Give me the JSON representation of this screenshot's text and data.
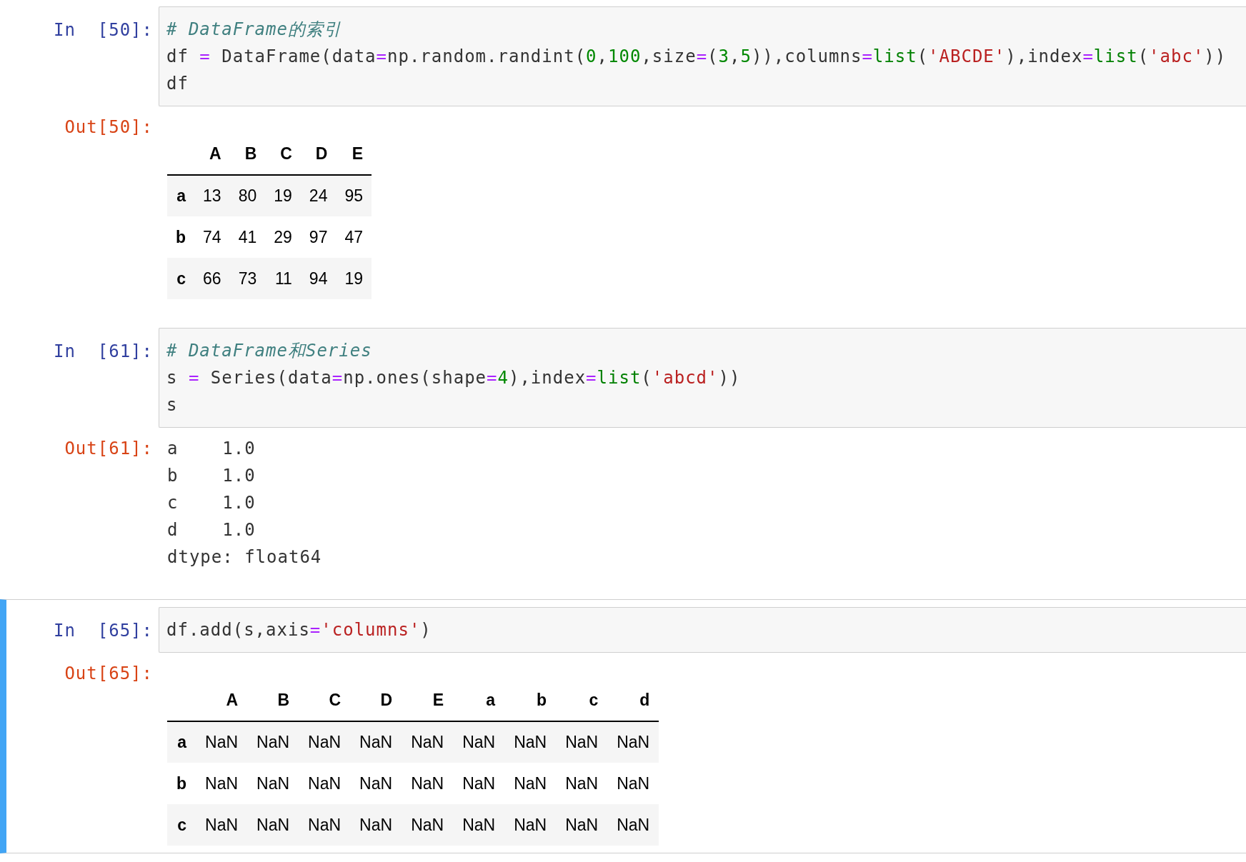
{
  "cells": [
    {
      "prompt": "In  [50]:",
      "selected": false,
      "code": [
        [
          {
            "t": "# DataFrame的索引",
            "kind": "comment"
          }
        ],
        [
          {
            "t": "df ",
            "kind": "plain"
          },
          {
            "t": "=",
            "kind": "op"
          },
          {
            "t": " DataFrame(data",
            "kind": "plain"
          },
          {
            "t": "=",
            "kind": "op"
          },
          {
            "t": "np.random.randint(",
            "kind": "plain"
          },
          {
            "t": "0",
            "kind": "number"
          },
          {
            "t": ",",
            "kind": "plain"
          },
          {
            "t": "100",
            "kind": "number"
          },
          {
            "t": ",size",
            "kind": "plain"
          },
          {
            "t": "=",
            "kind": "op"
          },
          {
            "t": "(",
            "kind": "plain"
          },
          {
            "t": "3",
            "kind": "number"
          },
          {
            "t": ",",
            "kind": "plain"
          },
          {
            "t": "5",
            "kind": "number"
          },
          {
            "t": ")),columns",
            "kind": "plain"
          },
          {
            "t": "=",
            "kind": "op"
          },
          {
            "t": "list",
            "kind": "builtin"
          },
          {
            "t": "(",
            "kind": "plain"
          },
          {
            "t": "'ABCDE'",
            "kind": "string"
          },
          {
            "t": "),index",
            "kind": "plain"
          },
          {
            "t": "=",
            "kind": "op"
          },
          {
            "t": "list",
            "kind": "builtin"
          },
          {
            "t": "(",
            "kind": "plain"
          },
          {
            "t": "'abc'",
            "kind": "string"
          },
          {
            "t": "))",
            "kind": "plain"
          }
        ],
        [
          {
            "t": "df",
            "kind": "plain"
          }
        ]
      ],
      "output": {
        "prompt": "Out[50]:",
        "kind": "table",
        "columns": [
          "A",
          "B",
          "C",
          "D",
          "E"
        ],
        "rows": [
          {
            "index": "a",
            "cells": [
              "13",
              "80",
              "19",
              "24",
              "95"
            ]
          },
          {
            "index": "b",
            "cells": [
              "74",
              "41",
              "29",
              "97",
              "47"
            ]
          },
          {
            "index": "c",
            "cells": [
              "66",
              "73",
              "11",
              "94",
              "19"
            ]
          }
        ]
      }
    },
    {
      "prompt": "In  [61]:",
      "selected": false,
      "code": [
        [
          {
            "t": "# DataFrame和Series",
            "kind": "comment"
          }
        ],
        [
          {
            "t": "s ",
            "kind": "plain"
          },
          {
            "t": "=",
            "kind": "op"
          },
          {
            "t": " Series(data",
            "kind": "plain"
          },
          {
            "t": "=",
            "kind": "op"
          },
          {
            "t": "np.ones(shape",
            "kind": "plain"
          },
          {
            "t": "=",
            "kind": "op"
          },
          {
            "t": "4",
            "kind": "number"
          },
          {
            "t": "),index",
            "kind": "plain"
          },
          {
            "t": "=",
            "kind": "op"
          },
          {
            "t": "list",
            "kind": "builtin"
          },
          {
            "t": "(",
            "kind": "plain"
          },
          {
            "t": "'abcd'",
            "kind": "string"
          },
          {
            "t": "))",
            "kind": "plain"
          }
        ],
        [
          {
            "t": "s",
            "kind": "plain"
          }
        ]
      ],
      "output": {
        "prompt": "Out[61]:",
        "kind": "text",
        "lines": [
          "a    1.0",
          "b    1.0",
          "c    1.0",
          "d    1.0",
          "dtype: float64"
        ]
      }
    },
    {
      "prompt": "In  [65]:",
      "selected": true,
      "code": [
        [
          {
            "t": "df.add(s,axis",
            "kind": "plain"
          },
          {
            "t": "=",
            "kind": "op"
          },
          {
            "t": "'columns'",
            "kind": "string"
          },
          {
            "t": ")",
            "kind": "plain"
          }
        ]
      ],
      "output": {
        "prompt": "Out[65]:",
        "kind": "table",
        "columns": [
          "A",
          "B",
          "C",
          "D",
          "E",
          "a",
          "b",
          "c",
          "d"
        ],
        "rows": [
          {
            "index": "a",
            "cells": [
              "NaN",
              "NaN",
              "NaN",
              "NaN",
              "NaN",
              "NaN",
              "NaN",
              "NaN",
              "NaN"
            ]
          },
          {
            "index": "b",
            "cells": [
              "NaN",
              "NaN",
              "NaN",
              "NaN",
              "NaN",
              "NaN",
              "NaN",
              "NaN",
              "NaN"
            ]
          },
          {
            "index": "c",
            "cells": [
              "NaN",
              "NaN",
              "NaN",
              "NaN",
              "NaN",
              "NaN",
              "NaN",
              "NaN",
              "NaN"
            ]
          }
        ]
      }
    }
  ]
}
